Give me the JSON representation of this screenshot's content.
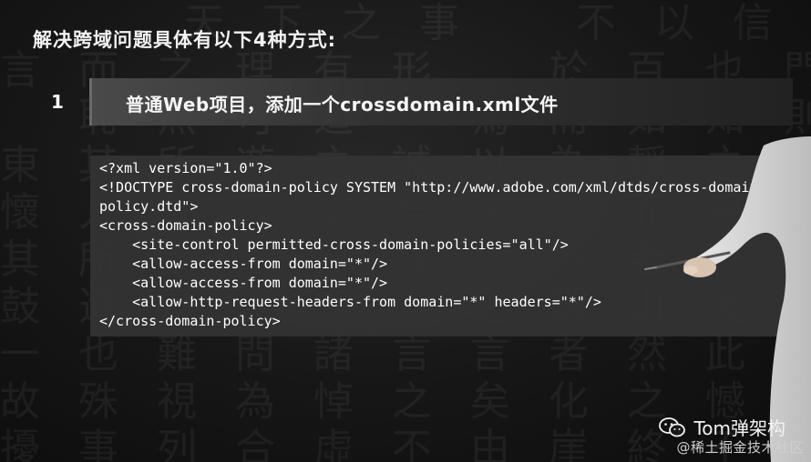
{
  "slide": {
    "title": "解决跨域问题具体有以下4种方式:",
    "step": {
      "number": "1",
      "label": "普通Web项目，添加一个crossdomain.xml文件"
    },
    "code_lines": [
      "<?xml version=\"1.0\"?>",
      "<!DOCTYPE cross-domain-policy SYSTEM \"http://www.adobe.com/xml/dtds/cross-domain-",
      "policy.dtd\">",
      "<cross-domain-policy>",
      "    <site-control permitted-cross-domain-policies=\"all\"/>",
      "    <allow-access-from domain=\"*\"/>",
      "    <allow-access-from domain=\"*\"/>",
      "    <allow-http-request-headers-from domain=\"*\" headers=\"*\"/>",
      "</cross-domain-policy>"
    ]
  },
  "watermark": {
    "channel": "Tom弹架构",
    "site": "@稀土掘金技术社区",
    "icon": "wechat-icon"
  },
  "colors": {
    "background": "#161616",
    "code_bg": "#343434",
    "step_bar": "#3a3a3a",
    "text": "#ffffff"
  }
}
